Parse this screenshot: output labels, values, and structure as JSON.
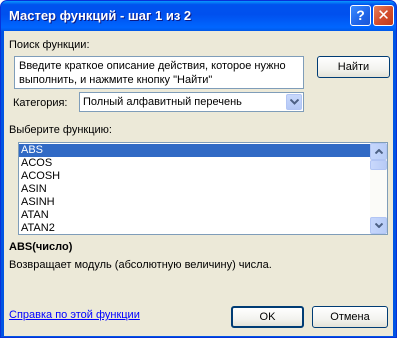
{
  "window": {
    "title": "Мастер функций - шаг 1 из 2",
    "help_glyph": "?",
    "close_glyph": "✕"
  },
  "search": {
    "label": "Поиск функции:",
    "description": "Введите краткое описание действия, которое нужно\nвыполнить, и нажмите кнопку \"Найти\"",
    "find_button": "Найти"
  },
  "category": {
    "label": "Категория:",
    "value": "Полный алфавитный перечень"
  },
  "functions": {
    "label": "Выберите функцию:",
    "items": [
      "ABS",
      "ACOS",
      "ACOSH",
      "ASIN",
      "ASINH",
      "ATAN",
      "ATAN2"
    ],
    "selected_index": 0
  },
  "selected_function": {
    "signature": "ABS(число)",
    "description": "Возвращает модуль (абсолютную величину) числа."
  },
  "footer": {
    "help_link": "Справка по этой функции",
    "ok_button": "OK",
    "cancel_button": "Отмена"
  },
  "colors": {
    "title_bar": "#0054e3",
    "dialog_face": "#ece9d8",
    "selection": "#316ac5",
    "link": "#0000ff"
  }
}
